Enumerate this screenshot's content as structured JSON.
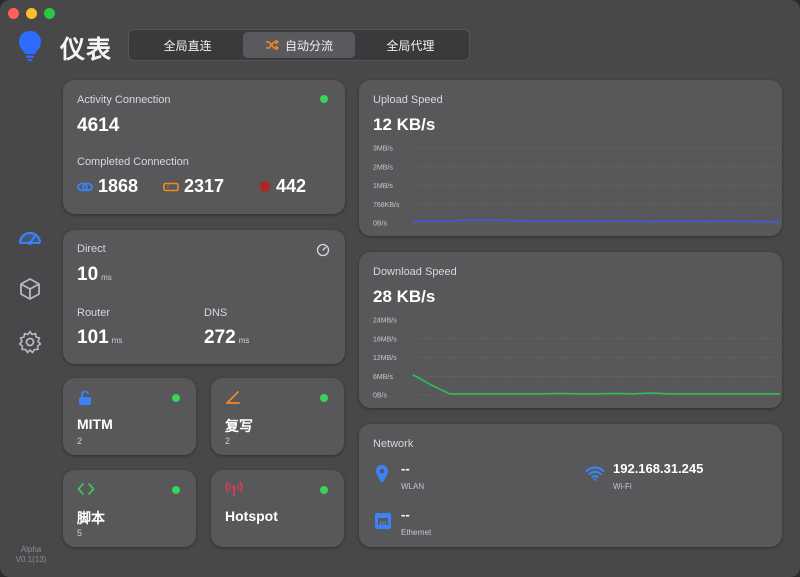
{
  "app": {
    "title": "仪表",
    "version_line1": "Alpha",
    "version_line2": "V0.1(13)"
  },
  "modes": [
    {
      "label": "全局直连",
      "active": false
    },
    {
      "label": "自动分流",
      "active": true,
      "icon": "shuffle-icon"
    },
    {
      "label": "全局代理",
      "active": false
    }
  ],
  "sidebar": {
    "items": [
      {
        "icon": "dashboard-icon",
        "active": true
      },
      {
        "icon": "box-icon",
        "active": false
      },
      {
        "icon": "gear-icon",
        "active": false
      }
    ]
  },
  "activity": {
    "title": "Activity Connection",
    "value": "4614",
    "completed_title": "Completed Connection",
    "stats": [
      {
        "icon": "link-icon",
        "value": "1868",
        "color": "#3b82f6"
      },
      {
        "icon": "ticket-icon",
        "value": "2317",
        "color": "#f08a24"
      },
      {
        "icon": "shield-icon",
        "value": "442",
        "color": "#e53935"
      }
    ]
  },
  "latency": {
    "direct_label": "Direct",
    "direct_value": "10",
    "router_label": "Router",
    "router_value": "101",
    "dns_label": "DNS",
    "dns_value": "272",
    "unit": "ms"
  },
  "tiles": [
    {
      "name": "MITM",
      "count": "2",
      "icon": "lock-open-icon",
      "color": "#3b82f6"
    },
    {
      "name": "复写",
      "count": "2",
      "icon": "pen-icon",
      "color": "#f08a24"
    },
    {
      "name": "脚本",
      "count": "5",
      "icon": "code-icon",
      "color": "#34c759"
    },
    {
      "name": "Hotspot",
      "count": "",
      "icon": "antenna-icon",
      "color": "#e53955"
    }
  ],
  "upload": {
    "title": "Upload Speed",
    "value": "12 KB/s",
    "ticks": [
      "3MB/s",
      "2MB/s",
      "1MB/s",
      "768KB/s",
      "0B/s"
    ],
    "color": "#3b5bdb",
    "points": [
      0.3,
      0.3,
      0.32,
      0.5,
      0.45,
      0.4,
      0.35,
      0.33,
      0.3,
      0.28,
      0.3,
      0.32,
      0.3,
      0.28,
      0.3,
      0.3,
      0.28,
      0.3,
      0.28,
      0.25,
      0.2
    ]
  },
  "download": {
    "title": "Download Speed",
    "value": "28 KB/s",
    "ticks": [
      "24MB/s",
      "18MB/s",
      "12MB/s",
      "6MB/s",
      "0B/s"
    ],
    "color": "#2fbf4e",
    "points": [
      6.5,
      3.2,
      0.4,
      0.4,
      0.4,
      0.4,
      0.4,
      0.4,
      0.5,
      0.4,
      0.4,
      0.5,
      0.4,
      0.6,
      0.4,
      0.4,
      0.4,
      0.4,
      0.4,
      0.4,
      0.4
    ]
  },
  "network": {
    "title": "Network",
    "wlan_value": "--",
    "wlan_label": "WLAN",
    "wifi_value": "192.168.31.245",
    "wifi_label": "Wi-Fi",
    "eth_value": "--",
    "eth_label": "Ethernet"
  },
  "colors": {
    "green_dot": "#3bd15a",
    "accent_blue": "#3b82f6"
  }
}
